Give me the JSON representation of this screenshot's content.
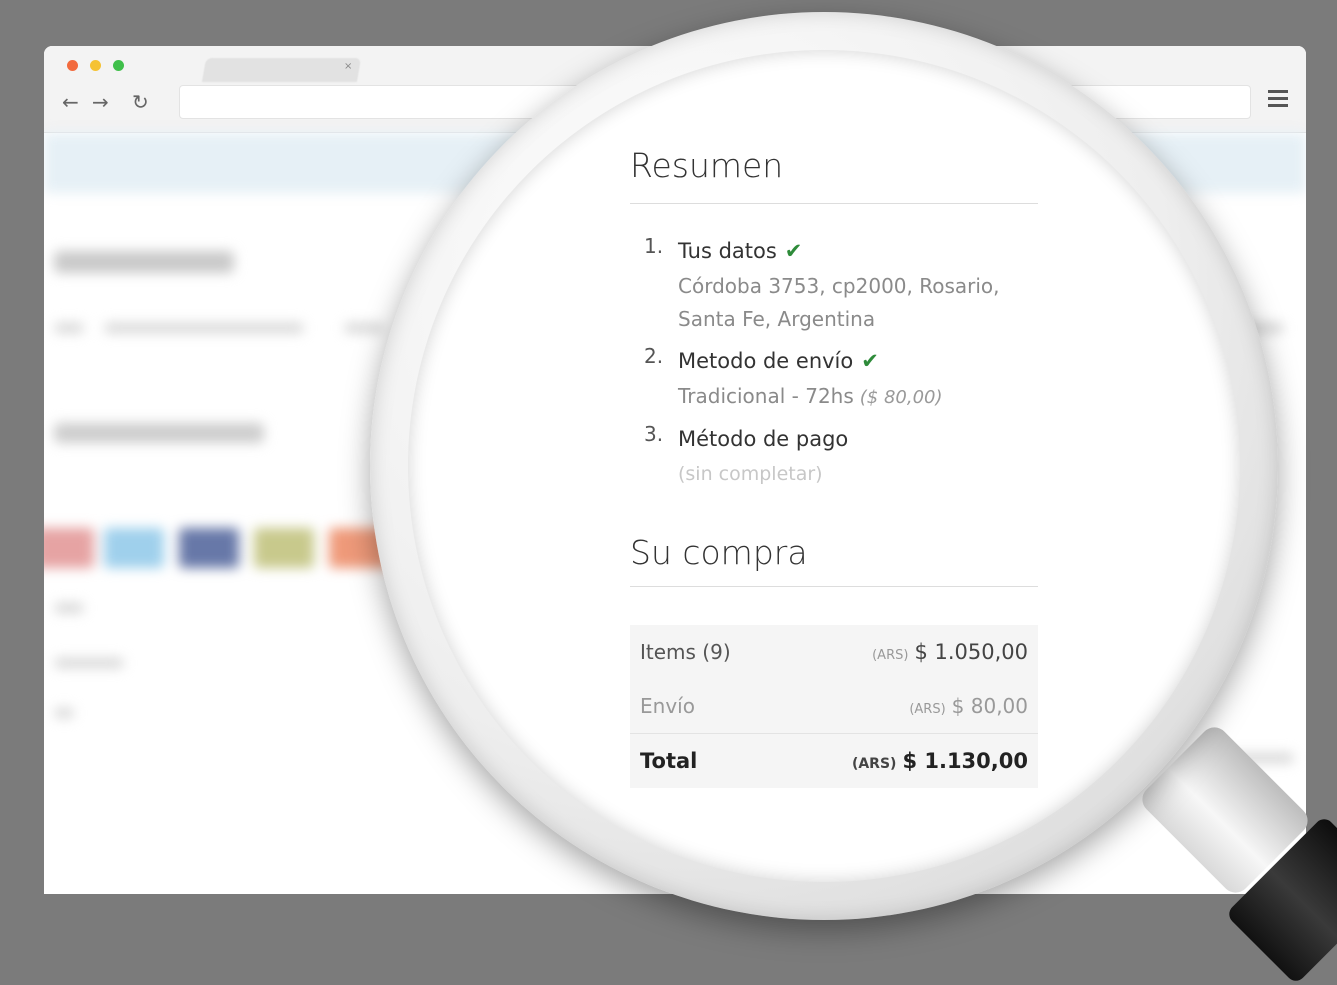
{
  "summary": {
    "title": "Resumen",
    "steps": [
      {
        "number": "1.",
        "label": "Tus datos",
        "detail_line1": "Córdoba 3753, cp2000, Rosario,",
        "detail_line2": "Santa Fe, Argentina",
        "done": true
      },
      {
        "number": "2.",
        "label": "Metodo de envío",
        "detail": "Tradicional - 72hs",
        "price": "($ 80,00)",
        "done": true
      },
      {
        "number": "3.",
        "label": "Método de pago",
        "detail": "(sin completar)",
        "done": false
      }
    ]
  },
  "purchase": {
    "title": "Su compra",
    "rows": {
      "items": {
        "label": "Items (9)",
        "currency": "(ARS)",
        "amount": "$ 1.050,00"
      },
      "shipping": {
        "label": "Envío",
        "currency": "(ARS)",
        "amount": "$ 80,00"
      },
      "total": {
        "label": "Total",
        "currency": "(ARS)",
        "amount": "$ 1.130,00"
      }
    }
  },
  "icons": {
    "check": "check-icon",
    "back": "back-arrow-icon",
    "forward": "forward-arrow-icon",
    "reload": "reload-icon",
    "menu": "hamburger-menu-icon"
  },
  "colors": {
    "check": "#2e8b3a",
    "background": "#7b7b7b"
  }
}
